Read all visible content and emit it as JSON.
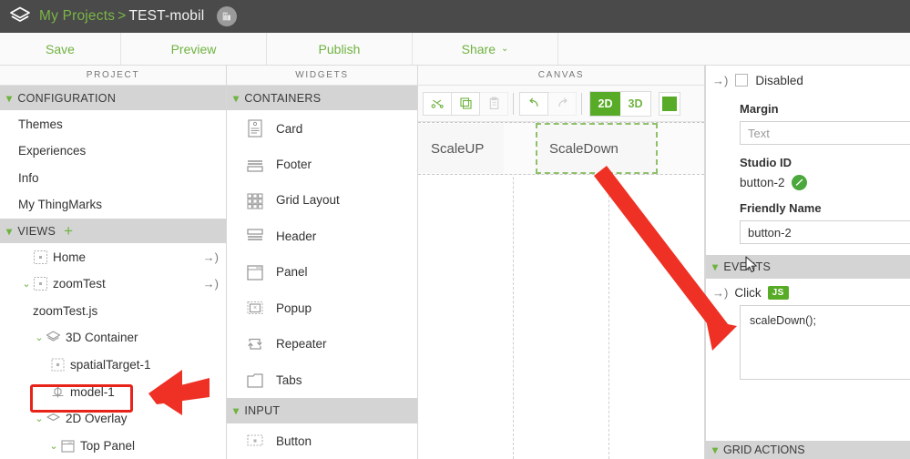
{
  "topbar": {
    "logo_icon": "layers-stack-icon",
    "breadcrumb_root": "My Projects",
    "breadcrumb_sep": ">",
    "breadcrumb_current": "TEST-mobil",
    "avatar_icon": "user-avatar-icon"
  },
  "menubar": {
    "items": [
      {
        "label": "Save",
        "name": "menu-save"
      },
      {
        "label": "Preview",
        "name": "menu-preview"
      },
      {
        "label": "Publish",
        "name": "menu-publish"
      },
      {
        "label": "Share",
        "name": "menu-share",
        "caret": "⌄"
      }
    ]
  },
  "project": {
    "header": "PROJECT",
    "configuration": {
      "label": "CONFIGURATION",
      "items": [
        {
          "label": "Themes"
        },
        {
          "label": "Experiences"
        },
        {
          "label": "Info"
        },
        {
          "label": "My ThingMarks"
        }
      ]
    },
    "views": {
      "label": "VIEWS",
      "add_icon": "plus-icon",
      "tree": [
        {
          "label": "Home",
          "icon": "view-icon",
          "indent": 1,
          "chevron": "",
          "goto": "→)"
        },
        {
          "label": "zoomTest",
          "icon": "view-icon",
          "indent": 1,
          "chevron": "⌄",
          "goto": "→)"
        },
        {
          "label": "zoomTest.js",
          "icon": "",
          "indent": 2,
          "chevron": "",
          "goto": ""
        },
        {
          "label": "3D Container",
          "icon": "container-3d-icon",
          "indent": 2,
          "chevron": "⌄",
          "goto": ""
        },
        {
          "label": "spatialTarget-1",
          "icon": "spatial-target-icon",
          "indent": 3,
          "chevron": "",
          "goto": ""
        },
        {
          "label": "model-1",
          "icon": "model-icon",
          "indent": 3,
          "chevron": "",
          "goto": "",
          "highlighted": true
        },
        {
          "label": "2D Overlay",
          "icon": "overlay-2d-icon",
          "indent": 2,
          "chevron": "⌄",
          "goto": ""
        },
        {
          "label": "Top Panel",
          "icon": "panel-icon",
          "indent": 3,
          "chevron": "⌄",
          "goto": ""
        }
      ]
    }
  },
  "widgets": {
    "header": "WIDGETS",
    "containers": {
      "label": "CONTAINERS",
      "items": [
        {
          "label": "Card",
          "icon": "card-icon"
        },
        {
          "label": "Footer",
          "icon": "footer-icon"
        },
        {
          "label": "Grid Layout",
          "icon": "grid-layout-icon"
        },
        {
          "label": "Header",
          "icon": "header-icon"
        },
        {
          "label": "Panel",
          "icon": "panel-icon"
        },
        {
          "label": "Popup",
          "icon": "popup-icon"
        },
        {
          "label": "Repeater",
          "icon": "repeater-icon"
        },
        {
          "label": "Tabs",
          "icon": "tabs-icon"
        }
      ]
    },
    "input": {
      "label": "INPUT",
      "items": [
        {
          "label": "Button",
          "icon": "button-icon"
        }
      ]
    }
  },
  "canvas": {
    "header": "CANVAS",
    "toolbar": {
      "cut_label": "Cut",
      "copy_label": "Copy",
      "paste_label": "Paste",
      "undo_label": "Undo",
      "redo_label": "Redo",
      "view_2d": "2D",
      "view_3d": "3D",
      "active_view": "2D"
    },
    "buttons": [
      {
        "label": "ScaleUP",
        "selected": false
      },
      {
        "label": "ScaleDown",
        "selected": true
      }
    ]
  },
  "properties": {
    "disabled_label": "Disabled",
    "disabled_checked": false,
    "goto_icon": "→)",
    "margin_label": "Margin",
    "margin_placeholder": "Text",
    "margin_value": "",
    "studio_id_label": "Studio ID",
    "studio_id_value": "button-2",
    "studio_id_status_icon": "validated-icon",
    "friendly_name_label": "Friendly Name",
    "friendly_name_value": "button-2",
    "events": {
      "header": "EVENTS",
      "click_label": "Click",
      "js_badge": "JS",
      "code": "scaleDown();"
    },
    "grid_actions_header": "GRID ACTIONS"
  },
  "colors": {
    "brand_green": "#6fb340",
    "active_green": "#58ab27",
    "topbar_bg": "#4a4a4a",
    "section_bg": "#d4d4d4",
    "annotation_red": "#e8231a"
  }
}
